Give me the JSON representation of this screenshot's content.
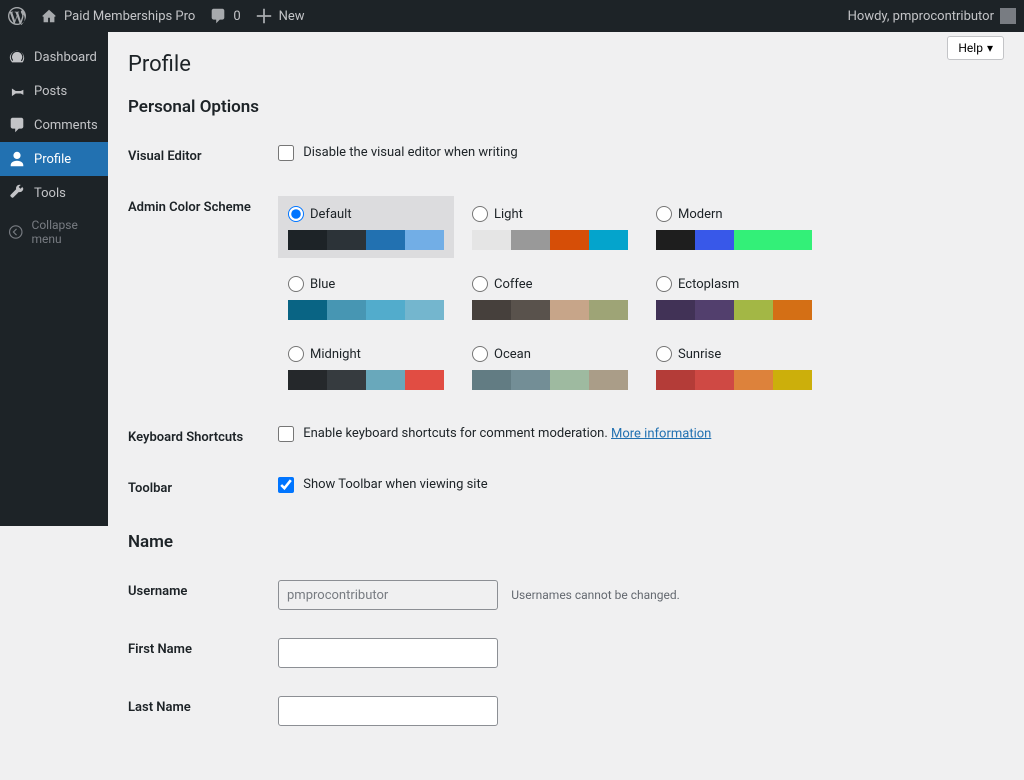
{
  "adminbar": {
    "site_title": "Paid Memberships Pro",
    "comments_count": "0",
    "new_label": "New",
    "howdy": "Howdy, pmprocontributor"
  },
  "sidebar": {
    "items": [
      {
        "label": "Dashboard"
      },
      {
        "label": "Posts"
      },
      {
        "label": "Comments"
      },
      {
        "label": "Profile"
      },
      {
        "label": "Tools"
      }
    ],
    "collapse": "Collapse menu"
  },
  "help_label": "Help",
  "page_title": "Profile",
  "sections": {
    "personal_options": "Personal Options",
    "name": "Name"
  },
  "rows": {
    "visual_editor": {
      "label": "Visual Editor",
      "checkbox": "Disable the visual editor when writing"
    },
    "admin_color": {
      "label": "Admin Color Scheme"
    },
    "keyboard": {
      "label": "Keyboard Shortcuts",
      "checkbox": "Enable keyboard shortcuts for comment moderation.",
      "link": "More information"
    },
    "toolbar": {
      "label": "Toolbar",
      "checkbox": "Show Toolbar when viewing site"
    },
    "username": {
      "label": "Username",
      "value": "pmprocontributor",
      "desc": "Usernames cannot be changed."
    },
    "first_name": {
      "label": "First Name"
    },
    "last_name": {
      "label": "Last Name"
    }
  },
  "color_schemes": [
    {
      "name": "Default",
      "colors": [
        "#1d2327",
        "#2c3338",
        "#2271b1",
        "#72aee6"
      ],
      "selected": true
    },
    {
      "name": "Light",
      "colors": [
        "#e5e5e5",
        "#999999",
        "#d64e07",
        "#04a4cc"
      ],
      "selected": false
    },
    {
      "name": "Modern",
      "colors": [
        "#1e1e1e",
        "#3858e9",
        "#33f078",
        "#33f078"
      ],
      "selected": false
    },
    {
      "name": "Blue",
      "colors": [
        "#096484",
        "#4796b3",
        "#52accc",
        "#74b6ce"
      ],
      "selected": false
    },
    {
      "name": "Coffee",
      "colors": [
        "#46403c",
        "#59524c",
        "#c7a589",
        "#9ea476"
      ],
      "selected": false
    },
    {
      "name": "Ectoplasm",
      "colors": [
        "#413256",
        "#523f6d",
        "#a3b745",
        "#d46f15"
      ],
      "selected": false
    },
    {
      "name": "Midnight",
      "colors": [
        "#25282b",
        "#363b3f",
        "#69a8bb",
        "#e14d43"
      ],
      "selected": false
    },
    {
      "name": "Ocean",
      "colors": [
        "#627c83",
        "#738e96",
        "#9ebaa0",
        "#aa9d88"
      ],
      "selected": false
    },
    {
      "name": "Sunrise",
      "colors": [
        "#b43c38",
        "#cf4944",
        "#dd823b",
        "#ccaf0b"
      ],
      "selected": false
    }
  ]
}
